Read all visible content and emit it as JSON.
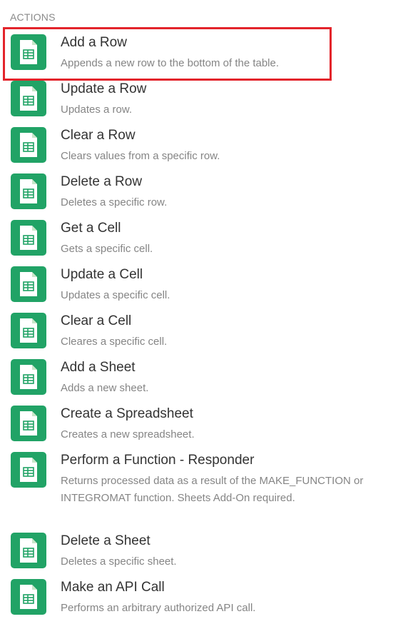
{
  "section": {
    "title": "ACTIONS"
  },
  "colors": {
    "icon_bg": "#21a366",
    "selected_outline": "#e3242b"
  },
  "icon_name": "google-sheets-icon",
  "actions": [
    {
      "title": "Add a Row",
      "description": "Appends a new row to the bottom of the table."
    },
    {
      "title": "Update a Row",
      "description": "Updates a row."
    },
    {
      "title": "Clear a Row",
      "description": "Clears values from a specific row."
    },
    {
      "title": "Delete a Row",
      "description": "Deletes a specific row."
    },
    {
      "title": "Get a Cell",
      "description": "Gets a specific cell."
    },
    {
      "title": "Update a Cell",
      "description": "Updates a specific cell."
    },
    {
      "title": "Clear a Cell",
      "description": "Cleares a specific cell."
    },
    {
      "title": "Add a Sheet",
      "description": "Adds a new sheet."
    },
    {
      "title": "Create a Spreadsheet",
      "description": "Creates a new spreadsheet."
    },
    {
      "title": "Perform a Function - Responder",
      "description": "Returns processed data as a result of the MAKE_FUNCTION or INTEGROMAT function. Sheets Add-On required."
    },
    {
      "title": "Delete a Sheet",
      "description": "Deletes a specific sheet."
    },
    {
      "title": "Make an API Call",
      "description": "Performs an arbitrary authorized API call."
    }
  ]
}
